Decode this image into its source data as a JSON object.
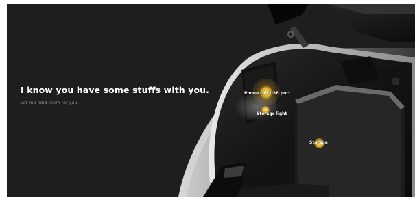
{
  "banner": {
    "headline": "I know you have some stuffs with  you.",
    "subline": "Let me hold them for you.",
    "colors": {
      "background": "#1e1e1e",
      "hotspot": "#f5be28",
      "headline": "#ffffff",
      "subline": "#8f8f8f"
    }
  },
  "hotspots": [
    {
      "label": "Phone call USB port",
      "icon": "hotspot-marker-icon"
    },
    {
      "label": "Storage light",
      "icon": "hotspot-marker-icon"
    },
    {
      "label": "Storage",
      "icon": "hotspot-marker-icon"
    }
  ]
}
